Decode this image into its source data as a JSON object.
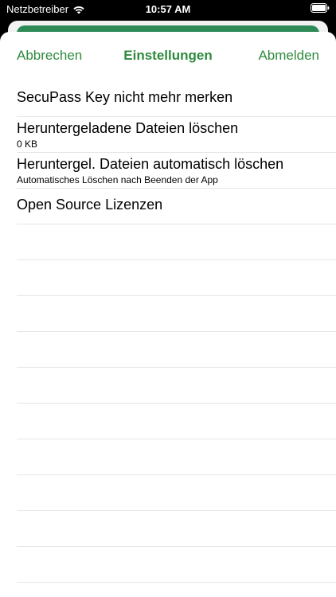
{
  "status_bar": {
    "carrier": "Netzbetreiber",
    "time": "10:57 AM"
  },
  "nav": {
    "cancel_label": "Abbrechen",
    "title": "Einstellungen",
    "logout_label": "Abmelden"
  },
  "settings": {
    "items": [
      {
        "title": "SecuPass Key nicht mehr merken",
        "subtitle": ""
      },
      {
        "title": "Heruntergeladene Dateien löschen",
        "subtitle": "0 KB"
      },
      {
        "title": "Heruntergel. Dateien automatisch löschen",
        "subtitle": "Automatisches Löschen nach Beenden der App"
      },
      {
        "title": "Open Source Lizenzen",
        "subtitle": ""
      }
    ]
  },
  "colors": {
    "accent": "#2e8b3e",
    "separator": "#e6e6e6"
  }
}
